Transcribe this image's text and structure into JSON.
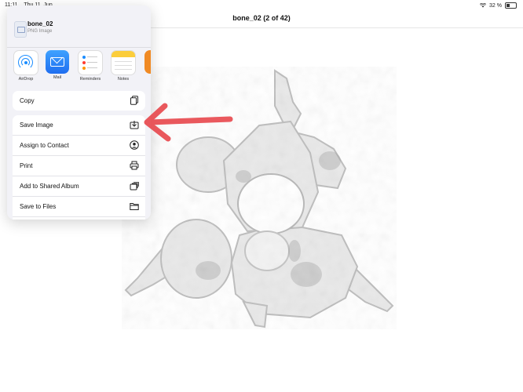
{
  "status_bar": {
    "time": "11:11",
    "date": "Thu 11. Jun",
    "battery_text": "32 %"
  },
  "viewer": {
    "title": "bone_02 (2 of 42)"
  },
  "share_sheet": {
    "file_name": "bone_02",
    "file_type": "PNG Image",
    "apps": [
      {
        "label": "AirDrop",
        "icon": "airdrop-icon"
      },
      {
        "label": "Mail",
        "icon": "mail-icon"
      },
      {
        "label": "Reminders",
        "icon": "reminders-icon"
      },
      {
        "label": "Notes",
        "icon": "notes-icon"
      },
      {
        "label": "B",
        "icon": "books-icon"
      }
    ],
    "copy_label": "Copy",
    "actions": [
      {
        "label": "Save Image",
        "icon": "save-image-icon"
      },
      {
        "label": "Assign to Contact",
        "icon": "contact-icon"
      },
      {
        "label": "Print",
        "icon": "printer-icon"
      },
      {
        "label": "Add to Shared Album",
        "icon": "shared-album-icon"
      },
      {
        "label": "Save to Files",
        "icon": "folder-icon"
      }
    ]
  },
  "colors": {
    "accent": "#1a8cff",
    "annotation_arrow": "#e8474c"
  }
}
